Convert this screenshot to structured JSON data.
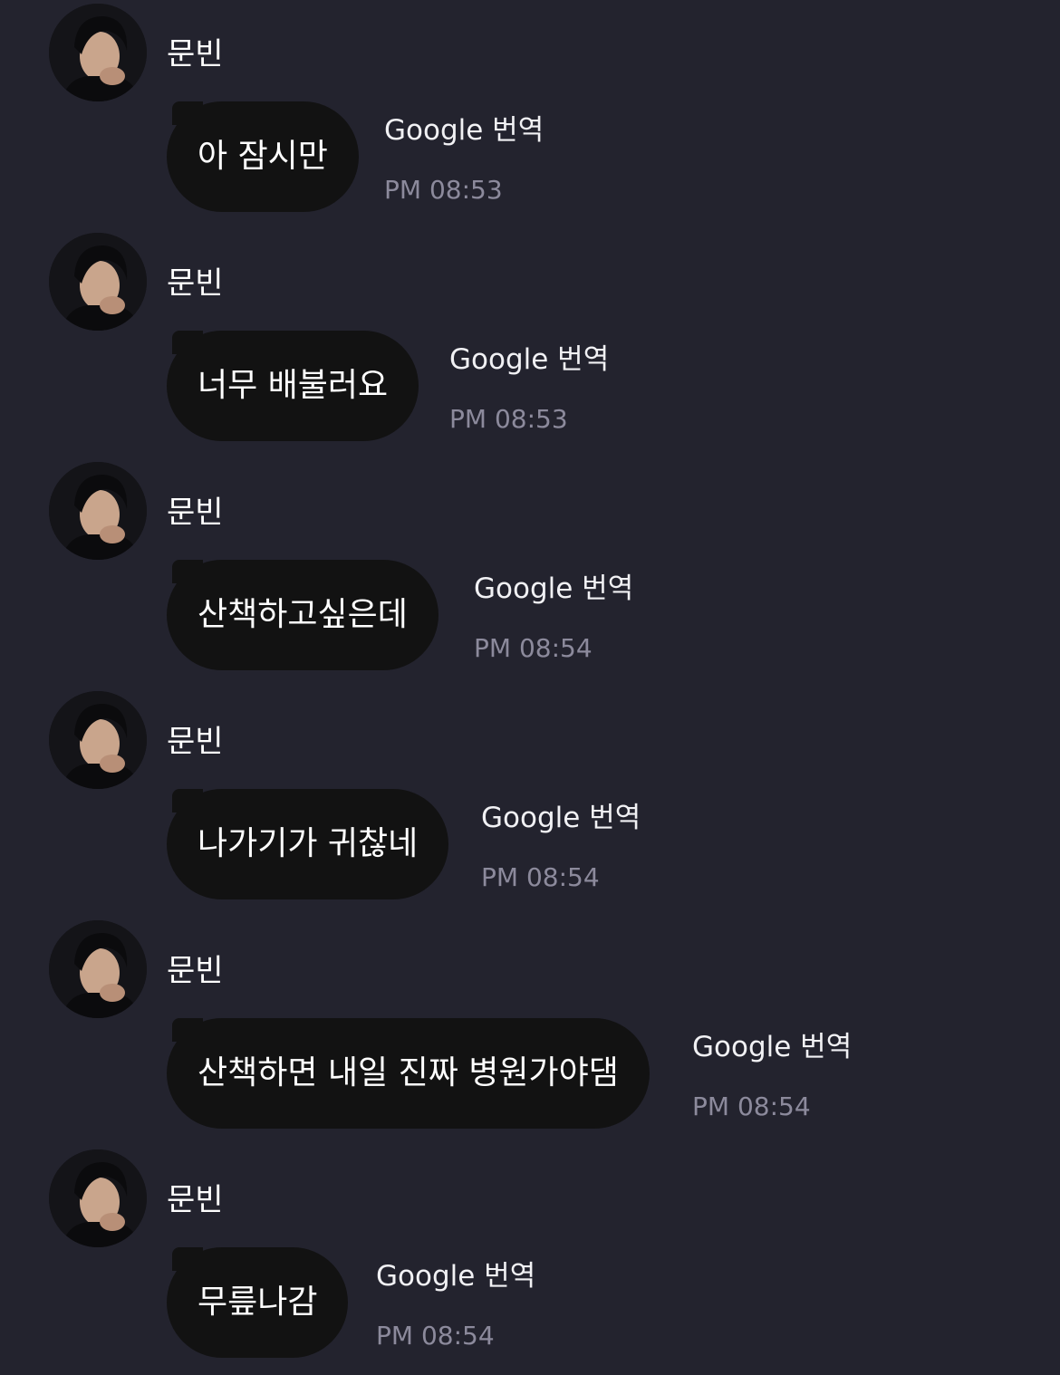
{
  "messages": [
    {
      "sender": "문빈",
      "text": "아 잠시만",
      "translate_label": "Google 번역",
      "time": "PM 08:53",
      "avatar_icon": "profile-photo"
    },
    {
      "sender": "문빈",
      "text": "너무 배불러요",
      "translate_label": "Google 번역",
      "time": "PM 08:53",
      "avatar_icon": "profile-photo"
    },
    {
      "sender": "문빈",
      "text": "산책하고싶은데",
      "translate_label": "Google 번역",
      "time": "PM 08:54",
      "avatar_icon": "profile-photo"
    },
    {
      "sender": "문빈",
      "text": "나가기가 귀찮네",
      "translate_label": "Google 번역",
      "time": "PM 08:54",
      "avatar_icon": "profile-photo"
    },
    {
      "sender": "문빈",
      "text": "산책하면 내일 진짜 병원가야댐",
      "translate_label": "Google 번역",
      "time": "PM 08:54",
      "avatar_icon": "profile-photo"
    },
    {
      "sender": "문빈",
      "text": "무릎나감",
      "translate_label": "Google 번역",
      "time": "PM 08:54",
      "avatar_icon": "profile-photo"
    }
  ],
  "colors": {
    "background": "#23232e",
    "bubble": "#121212",
    "text": "#ffffff",
    "timestamp": "#8c8a9c"
  }
}
